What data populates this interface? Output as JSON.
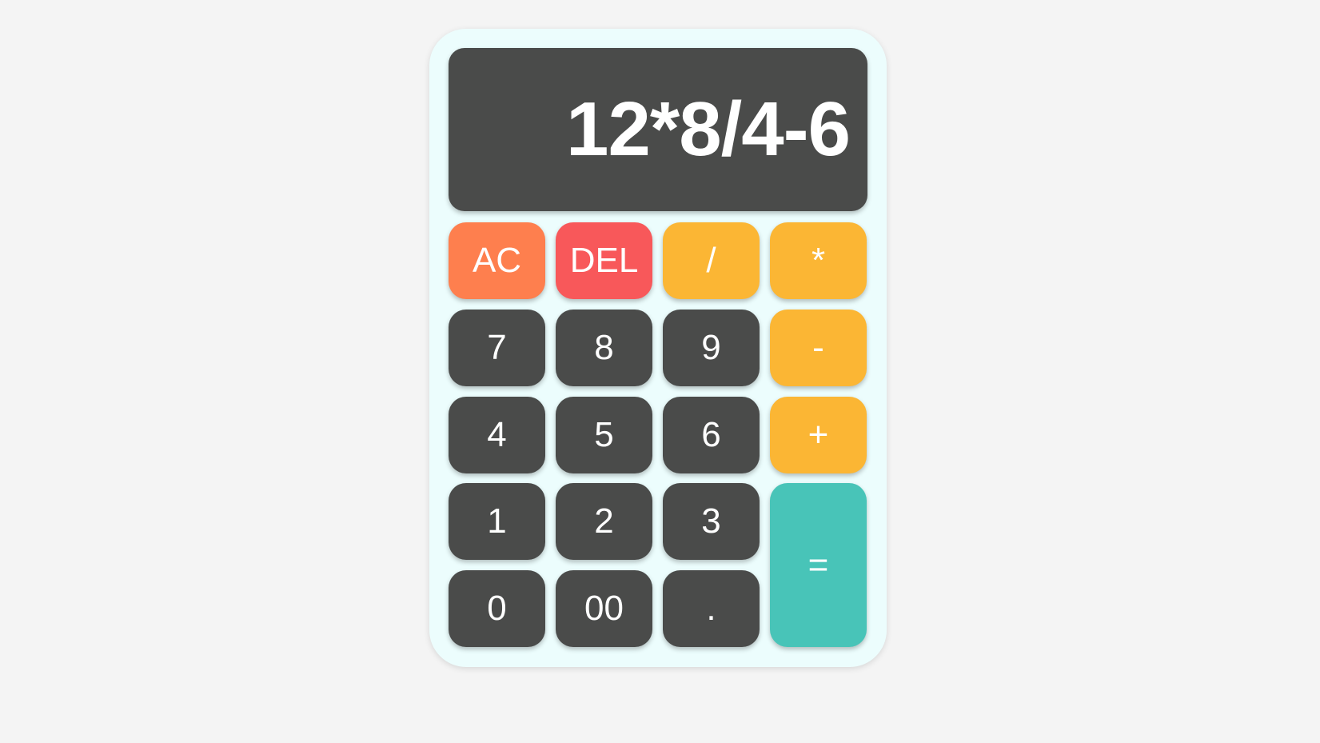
{
  "display": {
    "expression": "12*8/4-6"
  },
  "buttons": {
    "ac": "AC",
    "del": "DEL",
    "divide": "/",
    "multiply": "*",
    "seven": "7",
    "eight": "8",
    "nine": "9",
    "minus": "-",
    "four": "4",
    "five": "5",
    "six": "6",
    "plus": "+",
    "one": "1",
    "two": "2",
    "three": "3",
    "equals": "=",
    "zero": "0",
    "double_zero": "00",
    "decimal": "."
  },
  "colors": {
    "page_background": "#f4f4f4",
    "calculator_body": "#ecfdfd",
    "display_background": "#4a4b4a",
    "number_key": "#4a4b4a",
    "operator_key": "#fbb634",
    "ac_key": "#fe7f4e",
    "del_key": "#f8585a",
    "equals_key": "#48c4b8",
    "key_text": "#ffffff"
  }
}
